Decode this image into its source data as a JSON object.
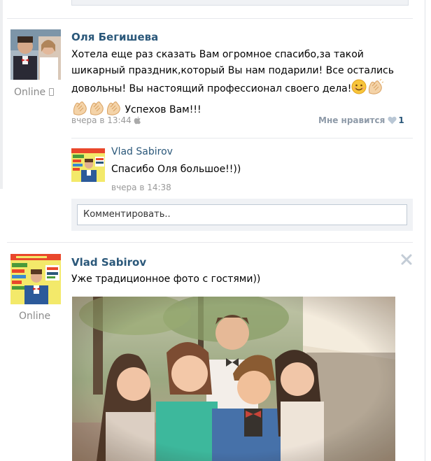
{
  "post1": {
    "author": "Оля Бегишева",
    "text_line1": "Хотела еще раз сказать Вам огромное спасибо,за такой",
    "text_line2": "шикарный праздник,который Вы нам подарили! Все остались",
    "text_line3": "довольны! Вы настоящий профессионал своего дела!",
    "text_line4": "Успехов Вам!!!",
    "time": "вчера в 13:44",
    "online": "Online",
    "like_label": "Мне нравится",
    "like_count": "1"
  },
  "reply": {
    "author": "Vlad Sabirov",
    "text": "Спасибо Оля большое!!))",
    "time": "вчера в 14:38"
  },
  "comment": {
    "placeholder": "Комментировать.."
  },
  "post2": {
    "author": "Vlad Sabirov",
    "text": "Уже традиционное фото с гостями))",
    "online": "Online"
  },
  "colors": {
    "link": "#2b587a",
    "meta": "#999999",
    "border": "#c0cad5",
    "comment_bg": "#f0f2f5"
  },
  "icons": [
    "phone-icon",
    "apple-icon",
    "heart-icon",
    "close-icon",
    "clapping-hands-emoji",
    "smiling-face-emoji"
  ]
}
